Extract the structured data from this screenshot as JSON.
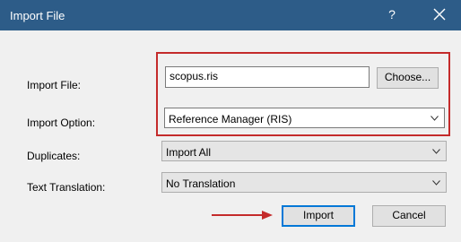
{
  "window": {
    "title": "Import File",
    "help_label": "?",
    "close_icon": "close-icon"
  },
  "form": {
    "import_file": {
      "label": "Import File:",
      "value": "scopus.ris",
      "browse_label": "Choose..."
    },
    "import_option": {
      "label": "Import Option:",
      "selected": "Reference Manager (RIS)"
    },
    "duplicates": {
      "label": "Duplicates:",
      "selected": "Import All"
    },
    "text_translation": {
      "label": "Text Translation:",
      "selected": "No Translation"
    }
  },
  "buttons": {
    "import_label": "Import",
    "cancel_label": "Cancel"
  },
  "annotations": {
    "highlight_color": "#c42b2b",
    "arrow_color": "#c42b2b"
  },
  "colors": {
    "titlebar": "#2d5c88",
    "accent": "#0078d7"
  }
}
